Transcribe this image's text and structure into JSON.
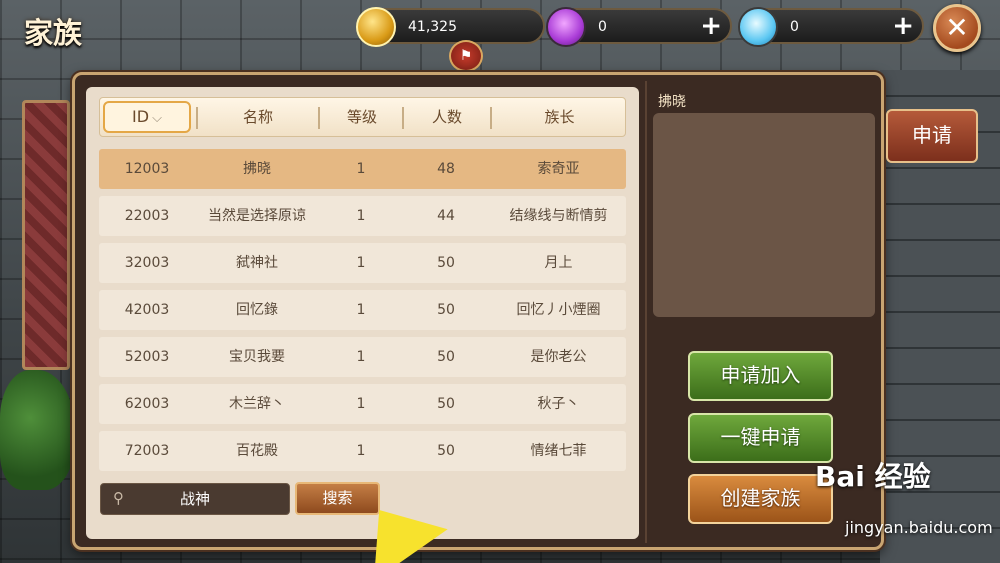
{
  "title": "家族",
  "currency": {
    "gold": "41,325",
    "gems": "0",
    "diamonds": "0",
    "plus": "+"
  },
  "close": "✕",
  "table": {
    "headers": [
      "ID",
      "名称",
      "等级",
      "人数",
      "族长"
    ],
    "sort_indicator": "⌵",
    "rows": [
      [
        "12003",
        "拂晓",
        "1",
        "48",
        "索奇亚"
      ],
      [
        "22003",
        "当然是选择原谅",
        "1",
        "44",
        "结缘线与断情剪"
      ],
      [
        "32003",
        "弑神社",
        "1",
        "50",
        "月上"
      ],
      [
        "42003",
        "回忆錄",
        "1",
        "50",
        "回忆丿小煙圈"
      ],
      [
        "52003",
        "宝贝我要",
        "1",
        "50",
        "是你老公"
      ],
      [
        "62003",
        "木兰辞丶",
        "1",
        "50",
        "秋子丶"
      ],
      [
        "72003",
        "百花殿",
        "1",
        "50",
        "情绪七菲"
      ]
    ],
    "selected_index": 0
  },
  "search": {
    "value": "战神",
    "button": "搜索"
  },
  "detail": {
    "name": "拂晓"
  },
  "buttons": {
    "join": "申请加入",
    "one_click": "一键申请",
    "create": "创建家族",
    "apply": "申请"
  },
  "watermark": {
    "brand": "Bai 经验",
    "url": "jingyan.baidu.com"
  }
}
